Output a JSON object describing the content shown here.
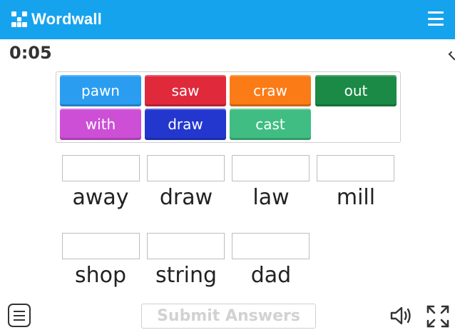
{
  "header": {
    "brand": "Wordwall",
    "brand_color": "#16a3ee",
    "menu_icon": "hamburger-menu-icon"
  },
  "timer": "0:05",
  "tray": {
    "tiles": [
      {
        "label": "pawn",
        "color": "#2a9df0"
      },
      {
        "label": "saw",
        "color": "#e02a3c"
      },
      {
        "label": "craw",
        "color": "#fb7b17"
      },
      {
        "label": "out",
        "color": "#1b8a46"
      },
      {
        "label": "with",
        "color": "#cc4fd6"
      },
      {
        "label": "draw",
        "color": "#2337cf"
      },
      {
        "label": "cast",
        "color": "#3fbd82"
      }
    ]
  },
  "targets": [
    {
      "word": "away"
    },
    {
      "word": "draw"
    },
    {
      "word": "law"
    },
    {
      "word": "mill"
    },
    {
      "word": "shop"
    },
    {
      "word": "string"
    },
    {
      "word": "dad"
    }
  ],
  "footer": {
    "submit_label": "Submit Answers",
    "menu_icon": "options-menu-icon",
    "sound_icon": "speaker-icon",
    "fullscreen_icon": "fullscreen-icon"
  }
}
